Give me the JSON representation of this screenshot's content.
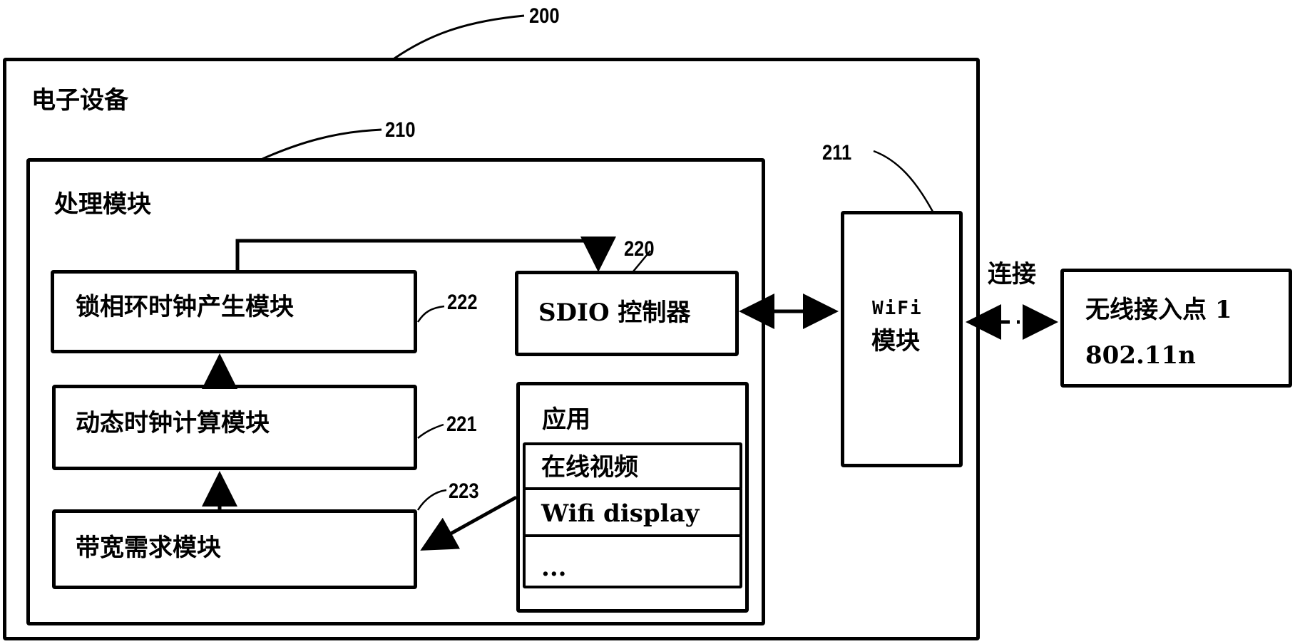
{
  "diagram": {
    "outer": {
      "title": "电子设备",
      "ref": "200"
    },
    "processing": {
      "title": "处理模块",
      "ref": "210"
    },
    "pll_module": {
      "label": "锁相环时钟产生模块",
      "ref": "222"
    },
    "dynamic_clock_module": {
      "label": "动态时钟计算模块",
      "ref": "221"
    },
    "bandwidth_module": {
      "label": "带宽需求模块",
      "ref": "223"
    },
    "sdio_controller": {
      "label": "SDIO 控制器",
      "ref": "220"
    },
    "applications": {
      "title": "应用",
      "items": [
        {
          "label": "在线视频"
        },
        {
          "label": "Wifi display"
        },
        {
          "label": "..."
        }
      ]
    },
    "wifi_module": {
      "line1": "WiFi",
      "line2": "模块",
      "ref": "211"
    },
    "connection_label": "连接",
    "access_point": {
      "line1": "无线接入点 1",
      "line2": "802.11n"
    },
    "connections": [
      {
        "from": "pll_module",
        "to": "sdio_controller",
        "style": "solid",
        "direction": "forward"
      },
      {
        "from": "dynamic_clock_module",
        "to": "pll_module",
        "style": "solid",
        "direction": "forward"
      },
      {
        "from": "bandwidth_module",
        "to": "dynamic_clock_module",
        "style": "solid",
        "direction": "forward"
      },
      {
        "from": "applications",
        "to": "bandwidth_module",
        "style": "solid",
        "direction": "forward"
      },
      {
        "from": "sdio_controller",
        "to": "wifi_module",
        "style": "solid",
        "direction": "bidirectional"
      },
      {
        "from": "wifi_module",
        "to": "access_point",
        "style": "dash-dot",
        "direction": "bidirectional"
      }
    ]
  }
}
